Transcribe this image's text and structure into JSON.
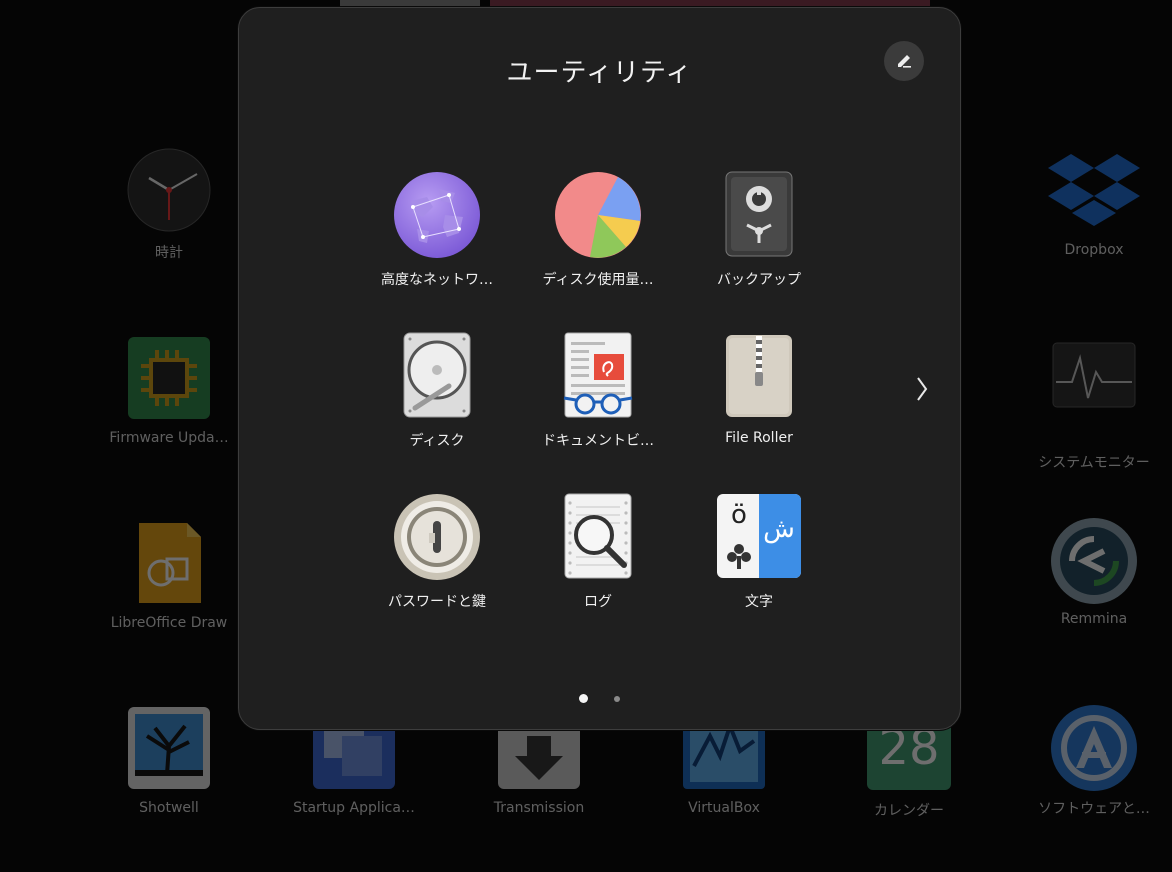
{
  "background_apps": [
    {
      "label": "時計"
    },
    {
      "label": "Dropbox"
    },
    {
      "label": "Firmware Upda…"
    },
    {
      "label": "システムモニター"
    },
    {
      "label": "LibreOffice Draw"
    },
    {
      "label": "Remmina"
    },
    {
      "label": "Shotwell"
    },
    {
      "label": "Startup Applica…"
    },
    {
      "label": "Transmission"
    },
    {
      "label": "VirtualBox"
    },
    {
      "label": "カレンダー"
    },
    {
      "label": "ソフトウェアと…"
    }
  ],
  "calendar_icon_number": "28",
  "folder": {
    "title": "ユーティリティ",
    "apps": [
      {
        "label": "高度なネットワ…"
      },
      {
        "label": "ディスク使用量…"
      },
      {
        "label": "バックアップ"
      },
      {
        "label": "ディスク"
      },
      {
        "label": "ドキュメントビ…"
      },
      {
        "label": "File Roller"
      },
      {
        "label": "パスワードと鍵"
      },
      {
        "label": "ログ"
      },
      {
        "label": "文字"
      }
    ],
    "character_icon_latin": "ö",
    "character_icon_arabic": "ش",
    "pages": 2,
    "current_page": 1
  }
}
